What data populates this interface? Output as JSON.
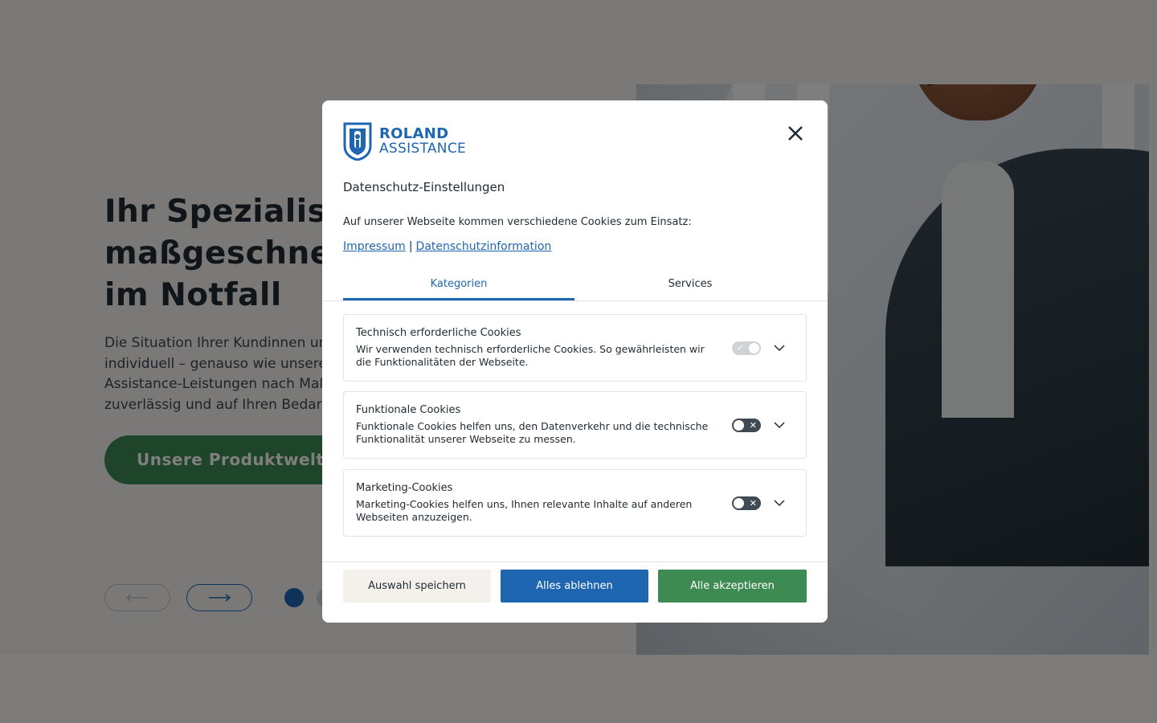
{
  "page": {
    "hero_title_line1": "Ihr Spezialist für",
    "hero_title_line2": "maßgeschneiderte Hilfe",
    "hero_title_line3": "im Notfall",
    "hero_text": "Die Situation Ihrer Kundinnen und Kunden ist individuell – genauso wie unsere Services. Assistance-Leistungen nach Maß: individuell, zuverlässig und auf Ihren Bedarf zugeschnitten.",
    "cta_label": "Unsere Produktwelt",
    "slider_prev_icon": "arrow-left-icon",
    "slider_next_icon": "arrow-right-icon"
  },
  "dialog": {
    "logo_line1": "ROLAND",
    "logo_line2": "ASSISTANCE",
    "title": "Datenschutz-Einstellungen",
    "intro": "Auf unserer Webseite kommen verschiedene Cookies zum Einsatz:",
    "link_impressum": "Impressum",
    "link_separator": "|",
    "link_datenschutz": "Datenschutzinformation",
    "tabs": [
      {
        "label": "Kategorien",
        "active": true
      },
      {
        "label": "Services",
        "active": false
      }
    ],
    "categories": [
      {
        "title": "Technisch erforderliche Cookies",
        "desc": "Wir verwenden technisch erforderliche Cookies. So gewährleisten wir die Funktionalitäten der Webseite.",
        "toggle": "on-disabled"
      },
      {
        "title": "Funktionale Cookies",
        "desc": "Funktionale Cookies helfen uns, den Datenverkehr und die technische Funktionalität unserer Webseite zu messen.",
        "toggle": "off"
      },
      {
        "title": "Marketing-Cookies",
        "desc": "Marketing-Cookies helfen uns, Ihnen relevante Inhalte auf anderen Web­seiten anzuzeigen.",
        "toggle": "off"
      }
    ],
    "buttons": {
      "save": "Auswahl speichern",
      "deny": "Alles ablehnen",
      "accept": "Alle akzeptieren"
    }
  },
  "colors": {
    "brand_blue": "#1f66b0",
    "accept_green": "#3d8a52",
    "overlay": "rgba(0,0,0,0.5)"
  }
}
